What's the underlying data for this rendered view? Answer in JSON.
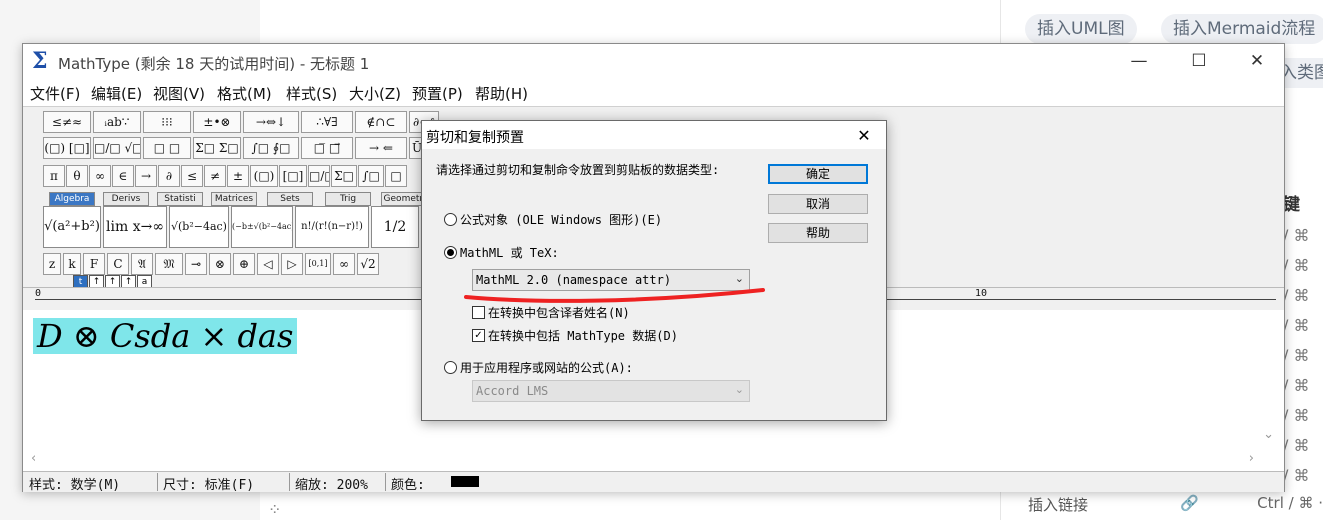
{
  "background": {
    "chips": [
      "插入UML图",
      "插入Mermaid流程",
      "入类图"
    ],
    "section_label": "键",
    "shortcut_glyph": "/ ⌘",
    "bottom_row": {
      "label": "插入链接",
      "shortcut": "Ctrl / ⌘ ·"
    }
  },
  "window": {
    "title": "MathType (剩余 18 天的试用时间) - 无标题 1",
    "controls": {
      "minimize": "—",
      "maximize": "☐",
      "close": "✕"
    },
    "menu": [
      "文件(F)",
      "编辑(E)",
      "视图(V)",
      "格式(M)",
      "样式(S)",
      "大小(Z)",
      "预置(P)",
      "帮助(H)"
    ],
    "palette": {
      "row1": [
        "≤≠≈",
        "ᵢab∵",
        "⁝⁝⁝",
        "±•⊗",
        "→⇔↓",
        "∴∀∃",
        "∉∩⊂",
        "∂∞ℓ"
      ],
      "row2": [
        "(□) [□]",
        "□/□ √□",
        "□ □",
        "Σ□ Σ□",
        "∫□ ∮□",
        "□̅ □⃗",
        "→ ⇐",
        "Ū Ů"
      ],
      "row3": [
        "π",
        "θ",
        "∞",
        "∈",
        "→",
        "∂",
        "≤",
        "≠",
        "±",
        "(□)",
        "[□]",
        "□/□",
        "Σ□",
        "∫□",
        "□"
      ],
      "tabs": [
        "Algebra",
        "Derivs",
        "Statisti",
        "Matrices",
        "Sets",
        "Trig",
        "Geometry"
      ],
      "templates": [
        "√(a²+b²)",
        "lim x→∞",
        "√(b²−4ac)",
        "(−b±√(b²−4ac))/2a",
        "n!/(r!(n−r)!)",
        "1/2"
      ],
      "row5": [
        "z",
        "k",
        "F",
        "C",
        "𝔄",
        "𝔐",
        "⊸",
        "⊗",
        "⊕",
        "◁",
        "▷",
        "[0,1]",
        "∞",
        "√2"
      ],
      "small_buttons": [
        "t",
        "↑",
        "↑",
        "↑",
        "a"
      ]
    },
    "ruler": {
      "start": "0",
      "mark": "10"
    },
    "formula": "D ⊗ Csda × das",
    "status": {
      "style": "样式: 数学(M)",
      "size": "尺寸: 标准(F)",
      "zoom": "缩放: 200%",
      "color": "颜色:",
      "color_value": "#000000"
    }
  },
  "dialog": {
    "title": "剪切和复制预置",
    "description": "请选择通过剪切和复制命令放置到剪贴板的数据类型:",
    "option_ole": "公式对象 (OLE Windows 图形)(E)",
    "option_mathml": "MathML 或 TeX:",
    "mathml_select": "MathML 2.0 (namespace attr)",
    "check_translator": "在转换中包含译者姓名(N)",
    "check_mathtype": "在转换中包括 MathType 数据(D)",
    "option_app": "用于应用程序或网站的公式(A):",
    "app_select": "Accord LMS",
    "buttons": {
      "ok": "确定",
      "cancel": "取消",
      "help": "帮助"
    },
    "selected_option": "MathML 或 TeX",
    "check_translator_on": false,
    "check_mathtype_on": true,
    "annotation_color": "#ee2222"
  }
}
